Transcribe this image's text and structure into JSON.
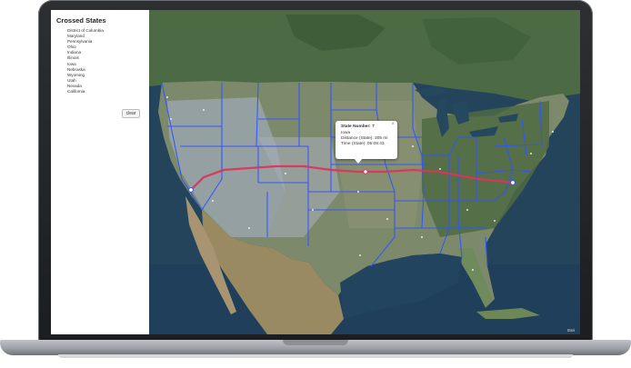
{
  "sidebar": {
    "title": "Crossed States",
    "states": [
      "District of Columbia",
      "Maryland",
      "Pennsylvania",
      "Ohio",
      "Indiana",
      "Illinois",
      "Iowa",
      "Nebraska",
      "Wyoming",
      "Utah",
      "Nevada",
      "California"
    ],
    "clear_label": "clear"
  },
  "popup": {
    "title": "State Number: 7",
    "state": "Iowa",
    "distance": "Distance (State): 305 mi",
    "time": "Time (State): 05:08:43",
    "close_icon": "×"
  },
  "map": {
    "attribution": "Esri",
    "colors": {
      "route": "#e0325a",
      "borders": "#2f56ff"
    }
  }
}
